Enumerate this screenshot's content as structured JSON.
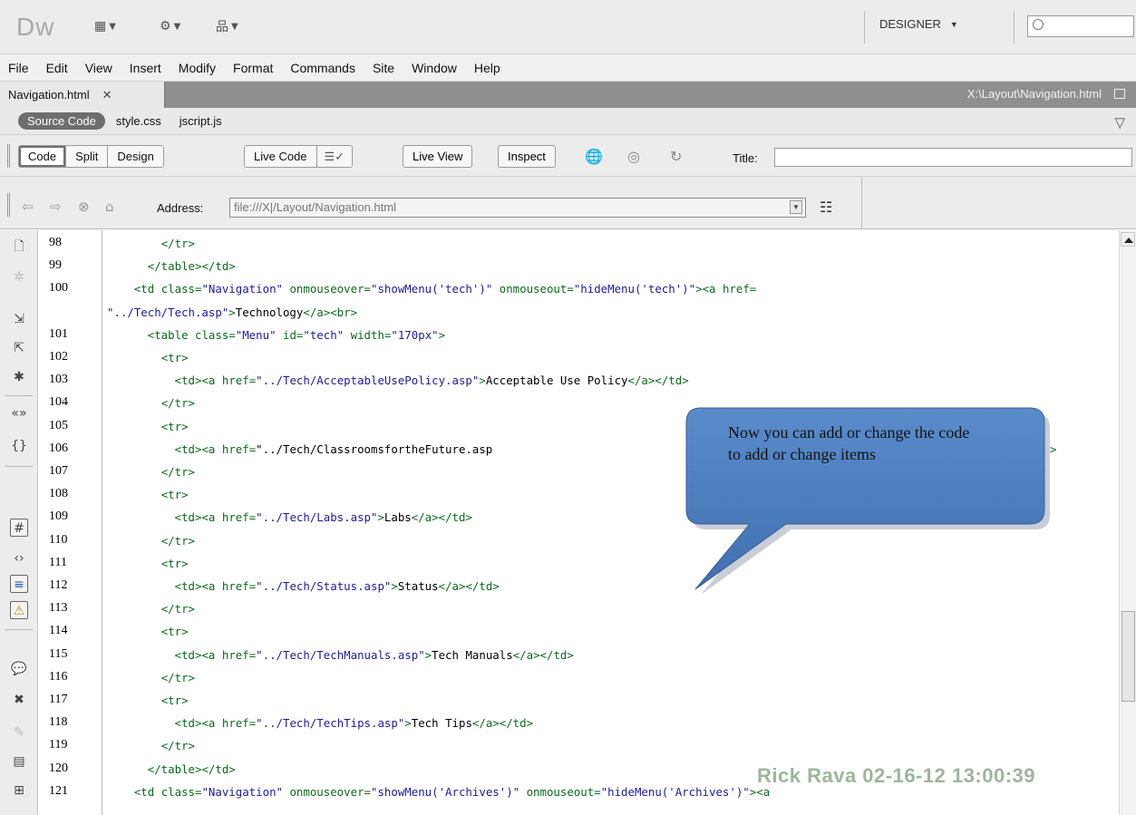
{
  "app": {
    "logo": "Dw",
    "workspace": "DESIGNER",
    "toolbar_icons": [
      "layout-icon",
      "gear-icon",
      "site-icon"
    ]
  },
  "menu": [
    "File",
    "Edit",
    "View",
    "Insert",
    "Modify",
    "Format",
    "Commands",
    "Site",
    "Window",
    "Help"
  ],
  "document": {
    "tab_label": "Navigation.html",
    "path": "X:\\Layout\\Navigation.html"
  },
  "related_files": {
    "source": "Source Code",
    "files": [
      "style.css",
      "jscript.js"
    ]
  },
  "doc_toolbar": {
    "view_buttons": [
      "Code",
      "Split",
      "Design"
    ],
    "live_code": "Live Code",
    "live_view": "Live View",
    "inspect": "Inspect",
    "title_label": "Title:",
    "title_value": ""
  },
  "address": {
    "label": "Address:",
    "value": "file:///X|/Layout/Navigation.html"
  },
  "code_lines": [
    {
      "num": "98",
      "code": "        </tr>"
    },
    {
      "num": "99",
      "code": "      </table></td>"
    },
    {
      "num": "100",
      "code": "    <td class=\"Navigation\" onmouseover=\"showMenu('tech')\" onmouseout=\"hideMenu('tech')\"><a href="
    },
    {
      "num": "",
      "code": "\"../Tech/Tech.asp\">Technology</a><br>"
    },
    {
      "num": "101",
      "code": "      <table class=\"Menu\" id=\"tech\" width=\"170px\">"
    },
    {
      "num": "102",
      "code": "        <tr>"
    },
    {
      "num": "103",
      "code": "          <td><a href=\"../Tech/AcceptableUsePolicy.asp\">Acceptable Use Policy</a></td>"
    },
    {
      "num": "104",
      "code": "        </tr>"
    },
    {
      "num": "105",
      "code": "        <tr>"
    },
    {
      "num": "106",
      "code": "          <td><a href=\"../Tech/ClassroomsfortheFuture.asp"
    },
    {
      "num": "107",
      "code": "        </tr>"
    },
    {
      "num": "108",
      "code": "        <tr>"
    },
    {
      "num": "109",
      "code": "          <td><a href=\"../Tech/Labs.asp\">Labs</a></td>"
    },
    {
      "num": "110",
      "code": "        </tr>"
    },
    {
      "num": "111",
      "code": "        <tr>"
    },
    {
      "num": "112",
      "code": "          <td><a href=\"../Tech/Status.asp\">Status</a></td>"
    },
    {
      "num": "113",
      "code": "        </tr>"
    },
    {
      "num": "114",
      "code": "        <tr>"
    },
    {
      "num": "115",
      "code": "          <td><a href=\"../Tech/TechManuals.asp\">Tech Manuals</a></td>"
    },
    {
      "num": "116",
      "code": "        </tr>"
    },
    {
      "num": "117",
      "code": "        <tr>"
    },
    {
      "num": "118",
      "code": "          <td><a href=\"../Tech/TechTips.asp\">Tech Tips</a></td>"
    },
    {
      "num": "119",
      "code": "        </tr>"
    },
    {
      "num": "120",
      "code": "      </table></td>"
    },
    {
      "num": "121",
      "code": "    <td class=\"Navigation\" onmouseover=\"showMenu('Archives')\" onmouseout=\"hideMenu('Archives')\"><a"
    }
  ],
  "line_106_tail": ">",
  "callout": {
    "text": "Now you can add or change the code to add or change items"
  },
  "watermark": "Rick Rava 02-16-12 13:00:39",
  "colors": {
    "tag": "#0a6a1a",
    "value": "#1a1aa8",
    "callout_fill": "#4f80bd",
    "watermark": "#9cb69a"
  }
}
